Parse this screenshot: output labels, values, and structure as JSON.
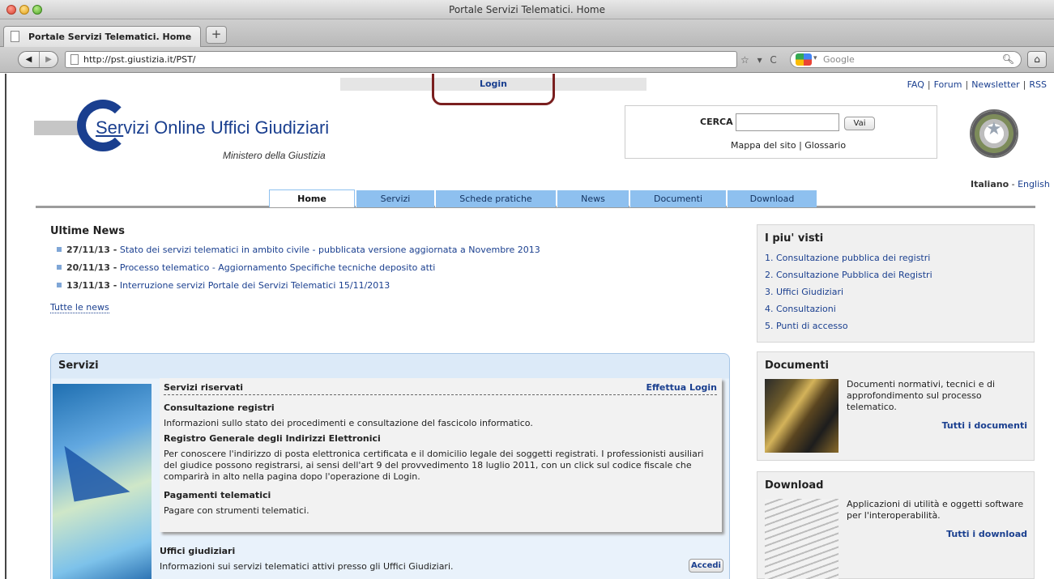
{
  "browser": {
    "window_title": "Portale Servizi Telematici. Home",
    "tab_title": "Portale Servizi Telematici. Home",
    "new_tab_label": "+",
    "url": "http://pst.giustizia.it/PST/",
    "search_engine": "Google",
    "icons": [
      "back-arrow-icon",
      "forward-arrow-icon",
      "page-icon",
      "star-icon",
      "reload-icon",
      "search-icon",
      "home-icon"
    ],
    "back_glyph": "◀",
    "forward_glyph": "▶",
    "url_icons": "☆ ▾ C",
    "search_glyph": "🔍︎",
    "home_glyph": "⌂",
    "dropdown_glyph": "▾"
  },
  "top": {
    "login": "Login",
    "links": [
      "FAQ",
      "Forum",
      "Newsletter",
      "RSS"
    ],
    "separator": "|"
  },
  "header": {
    "logo_first": "Ser",
    "logo_first_rest": "vizi",
    "logo_rest": " Online ",
    "logo_blue": "Uffici Giudiziari",
    "subtitle": "Ministero della Giustizia",
    "search_label": "CERCA",
    "search_button": "Vai",
    "site_links": "Mappa del sito  |  Glossario",
    "lang_current": "Italiano",
    "lang_sep": " - ",
    "lang_other": "English"
  },
  "nav": {
    "tabs": [
      "Home",
      "Servizi",
      "Schede pratiche",
      "News",
      "Documenti",
      "Download"
    ],
    "active": "Home"
  },
  "news": {
    "title": "Ultime News",
    "items": [
      {
        "date": "27/11/13 -",
        "text": "Stato dei servizi telematici in ambito civile - pubblicata versione aggiornata a Novembre 2013"
      },
      {
        "date": "20/11/13 -",
        "text": "Processo telematico - Aggiornamento Specifiche tecniche deposito atti"
      },
      {
        "date": "13/11/13 -",
        "text": "Interruzione servizi Portale dei Servizi Telematici 15/11/2013"
      }
    ],
    "all": "Tutte le news"
  },
  "servizi": {
    "title": "Servizi",
    "reserved_title": "Servizi riservati",
    "reserved_login": "Effettua Login",
    "items": [
      {
        "head": "Consultazione registri",
        "text": "Informazioni sullo stato dei procedimenti e consultazione del fascicolo informatico."
      },
      {
        "head": "Registro Generale degli Indirizzi Elettronici",
        "text": "Per conoscere l'indirizzo di posta elettronica certificata e il domicilio legale dei soggetti registrati. I professionisti ausiliari del giudice possono registrarsi, ai sensi dell'art 9 del provvedimento 18 luglio 2011, con un click sul codice fiscale che comparirà in alto nella pagina dopo l'operazione di Login."
      },
      {
        "head": "Pagamenti telematici",
        "text": "Pagare con strumenti telematici."
      }
    ],
    "uffici_title": "Uffici giudiziari",
    "uffici_desc": "Informazioni sui servizi telematici attivi presso gli Uffici Giudiziari.",
    "accedi": "Accedi"
  },
  "sidebar": {
    "visti_title": "I piu' visti",
    "visti": [
      "1. Consultazione pubblica dei registri",
      "2. Consultazione Pubblica dei Registri",
      "3. Uffici Giudiziari",
      "4. Consultazioni",
      "5. Punti di accesso"
    ],
    "documenti_title": "Documenti",
    "documenti_desc": "Documenti normativi, tecnici e di approfondimento sul processo telematico.",
    "documenti_more": "Tutti i documenti",
    "download_title": "Download",
    "download_desc": "Applicazioni di utilità e oggetti software per l'interoperabilità.",
    "download_more": "Tutti i download"
  },
  "colors": {
    "brand_blue": "#1a3f8f",
    "nav_tab": "#8ec0ef",
    "highlight": "#7a1f1f"
  }
}
